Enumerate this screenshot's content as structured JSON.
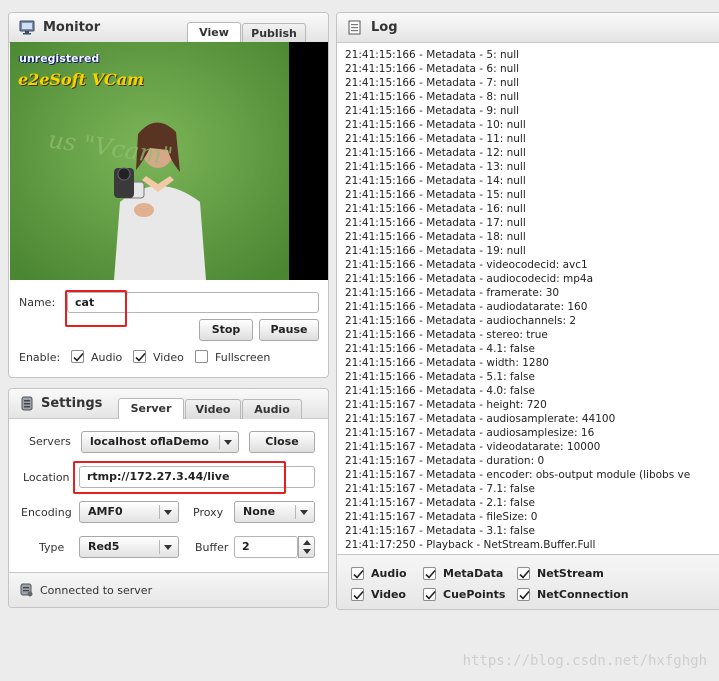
{
  "monitor": {
    "title": "Monitor",
    "tabs": [
      {
        "label": "View",
        "active": true
      },
      {
        "label": "Publish",
        "active": false
      }
    ],
    "video": {
      "badge_top": "unregistered",
      "badge_bottom": "e2eSoft VCam",
      "bg_text": "us \"Vcam\""
    },
    "name_label": "Name:",
    "name_value": "cat",
    "stop_label": "Stop",
    "pause_label": "Pause",
    "enable_label": "Enable:",
    "audio_label": "Audio",
    "audio_checked": true,
    "video_label": "Video",
    "video_checked": true,
    "fullscreen_label": "Fullscreen",
    "fullscreen_checked": false
  },
  "settings": {
    "title": "Settings",
    "tabs": [
      {
        "label": "Server",
        "active": true
      },
      {
        "label": "Video",
        "active": false
      },
      {
        "label": "Audio",
        "active": false
      }
    ],
    "servers_label": "Servers",
    "servers_value": "localhost oflaDemo",
    "close_label": "Close",
    "location_label": "Location",
    "location_value": "rtmp://172.27.3.44/live",
    "encoding_label": "Encoding",
    "encoding_value": "AMF0",
    "proxy_label": "Proxy",
    "proxy_value": "None",
    "type_label": "Type",
    "type_value": "Red5",
    "buffer_label": "Buffer",
    "buffer_value": "2",
    "status_text": "Connected to server"
  },
  "log": {
    "title": "Log",
    "lines": [
      "21:41:15:166 - Metadata - 5: null",
      "21:41:15:166 - Metadata - 6: null",
      "21:41:15:166 - Metadata - 7: null",
      "21:41:15:166 - Metadata - 8: null",
      "21:41:15:166 - Metadata - 9: null",
      "21:41:15:166 - Metadata - 10: null",
      "21:41:15:166 - Metadata - 11: null",
      "21:41:15:166 - Metadata - 12: null",
      "21:41:15:166 - Metadata - 13: null",
      "21:41:15:166 - Metadata - 14: null",
      "21:41:15:166 - Metadata - 15: null",
      "21:41:15:166 - Metadata - 16: null",
      "21:41:15:166 - Metadata - 17: null",
      "21:41:15:166 - Metadata - 18: null",
      "21:41:15:166 - Metadata - 19: null",
      "21:41:15:166 - Metadata - videocodecid: avc1",
      "21:41:15:166 - Metadata - audiocodecid: mp4a",
      "21:41:15:166 - Metadata - framerate: 30",
      "21:41:15:166 - Metadata - audiodatarate: 160",
      "21:41:15:166 - Metadata - audiochannels: 2",
      "21:41:15:166 - Metadata - stereo: true",
      "21:41:15:166 - Metadata - 4.1: false",
      "21:41:15:166 - Metadata - width: 1280",
      "21:41:15:166 - Metadata - 5.1: false",
      "21:41:15:166 - Metadata - 4.0: false",
      "21:41:15:167 - Metadata - height: 720",
      "21:41:15:167 - Metadata - audiosamplerate: 44100",
      "21:41:15:167 - Metadata - audiosamplesize: 16",
      "21:41:15:167 - Metadata - videodatarate: 10000",
      "21:41:15:167 - Metadata - duration: 0",
      "21:41:15:167 - Metadata - encoder: obs-output module (libobs ve",
      "21:41:15:167 - Metadata - 7.1: false",
      "21:41:15:167 - Metadata - 2.1: false",
      "21:41:15:167 - Metadata - fileSize: 0",
      "21:41:15:167 - Metadata - 3.1: false",
      "21:41:17:250 - Playback - NetStream.Buffer.Full"
    ],
    "filters": [
      {
        "label": "Audio",
        "checked": true
      },
      {
        "label": "MetaData",
        "checked": true
      },
      {
        "label": "NetStream",
        "checked": true
      },
      {
        "label": "Video",
        "checked": true
      },
      {
        "label": "CuePoints",
        "checked": true
      },
      {
        "label": "NetConnection",
        "checked": true
      }
    ]
  },
  "watermark": "https://blog.csdn.net/hxfghgh",
  "colors": {
    "highlight": "#e41f1f",
    "video_green": "#5f9a3f"
  }
}
